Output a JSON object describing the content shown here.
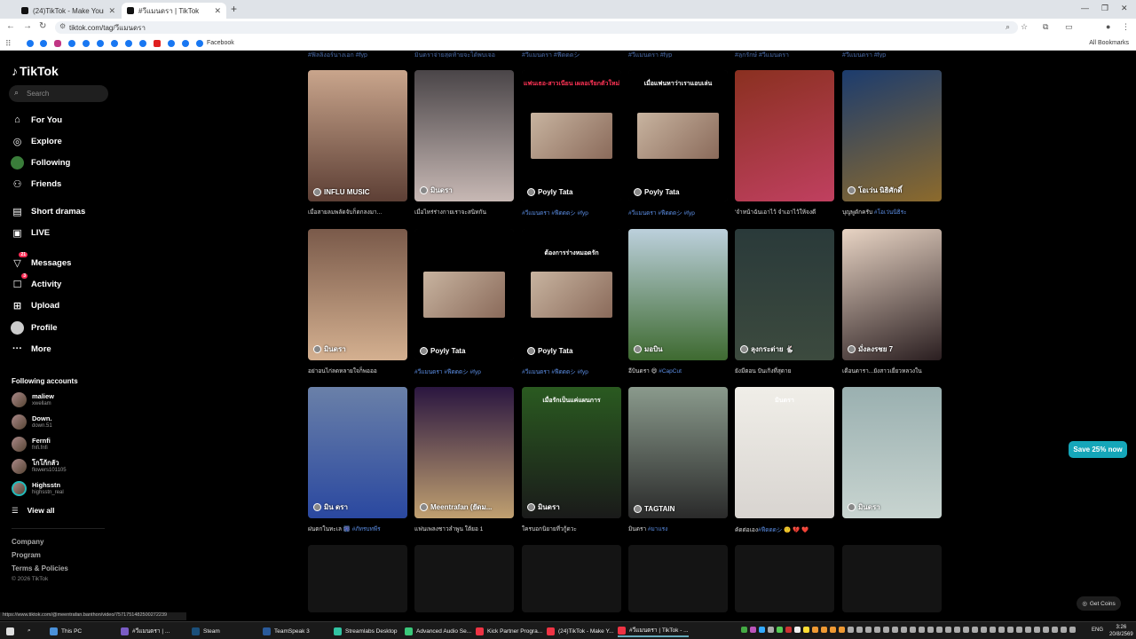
{
  "browser": {
    "tabs": [
      {
        "title": "(24)TikTok - Make Your Day",
        "active": false
      },
      {
        "title": "#วีแมนดรา | TikTok",
        "active": true
      }
    ],
    "url": "tiktok.com/tag/วีแมนดรา",
    "bookmarks_label": "Facebook",
    "all_bookmarks": "All Bookmarks"
  },
  "sidebar": {
    "logo": "TikTok",
    "search_placeholder": "Search",
    "nav": [
      {
        "label": "For You",
        "icon": "home-icon"
      },
      {
        "label": "Explore",
        "icon": "compass-icon"
      },
      {
        "label": "Following",
        "icon": "following-avatar"
      },
      {
        "label": "Friends",
        "icon": "friends-icon"
      },
      {
        "label": "Short dramas",
        "icon": "film-icon"
      },
      {
        "label": "LIVE",
        "icon": "live-icon"
      },
      {
        "label": "Messages",
        "icon": "message-icon",
        "badge": "21"
      },
      {
        "label": "Activity",
        "icon": "activity-icon",
        "badge": "3"
      },
      {
        "label": "Upload",
        "icon": "upload-icon"
      },
      {
        "label": "Profile",
        "icon": "profile-avatar"
      },
      {
        "label": "More",
        "icon": "more-icon"
      }
    ],
    "following_title": "Following accounts",
    "accounts": [
      {
        "name": "maliew",
        "handle": "xwellam"
      },
      {
        "name": "Down.",
        "handle": "down.51"
      },
      {
        "name": "Fernfi",
        "handle": "fnfi.fnfi"
      },
      {
        "name": "โกโก้กลัว",
        "handle": "flowers101105"
      },
      {
        "name": "Highsstn",
        "handle": "highsstn_real"
      }
    ],
    "view_all": "View all",
    "footer": [
      "Company",
      "Program",
      "Terms & Policies"
    ],
    "copyright": "© 2026 TikTok"
  },
  "grid": {
    "top_row_partial": [
      "#ฟิลลิงอร์นางเอก #fyp",
      "มินดราจ่ายสุดท้ายจะได้พบเจอ",
      "#วีแมนดรา #ฟีดดดシ",
      "#วีแมนดรา #fyp",
      "#ลูกรักษ์ #วีแมนดรา",
      "#วีแมนดรา #fyp"
    ],
    "rows": [
      [
        {
          "owner": "INFLU MUSIC",
          "caption": "เมื่อสายลมพลัดจับก็ตกลงมา...",
          "tag": "",
          "overlay": ""
        },
        {
          "owner": "มินดรา",
          "caption": "เมื่อไหร่ร่างกายเราจะสนิทกัน",
          "tag": "",
          "overlay": ""
        },
        {
          "owner": "Poyly Tata",
          "caption": "",
          "tag": "#วีแมนดรา #ฟีดดดシ #fyp",
          "overlay": "แฟนเธอ-สาวเนียน เผลอเรียกตัวใหม่"
        },
        {
          "owner": "Poyly Tata",
          "caption": "",
          "tag": "#วีแมนดรา #ฟีดดดシ #fyp",
          "overlay": "เมื่อแฟนหาว่าเราแอบเล่น"
        },
        {
          "owner": "",
          "caption": "'จำหน้าฉันเอาไว้ จำเอาไว้ให้จงดี",
          "tag": "",
          "overlay": ""
        },
        {
          "owner": "โอเว่น นิธิศักดิ์",
          "caption": "บุญพูดักครับ ",
          "tag": "#โอเว่นนิธิระ",
          "overlay": ""
        }
      ],
      [
        {
          "owner": "มินดรา",
          "caption": "อย่าอนไก่ลดหลายใจก็พอออ",
          "tag": "",
          "overlay": ""
        },
        {
          "owner": "Poyly Tata",
          "caption": "",
          "tag": "#วีแมนดรา #ฟีดดดシ #fyp",
          "overlay": ""
        },
        {
          "owner": "Poyly Tata",
          "caption": "",
          "tag": "#วีแมนดรา #ฟีดดดシ #fyp",
          "overlay": "ต้องการร่างหมอดรัก"
        },
        {
          "owner": "มอบิน",
          "caption": "อีบินดรา 😄 ",
          "tag": "#CapCut",
          "overlay": ""
        },
        {
          "owner": "ลุงกระต่าย 🐇",
          "caption": "ยังมีตอน ปันเกิงที่สุดาย",
          "tag": "",
          "overlay": ""
        },
        {
          "owner": "มั่งลงรชย 7",
          "caption": "เดือนดารา...ยังสาวเยี่ยวหลวงใน",
          "tag": "",
          "overlay": ""
        }
      ],
      [
        {
          "owner": "มิน ดรา",
          "caption": "ฝนตกในทะเล 🎆 ",
          "tag": "#ภัทรบทพีร",
          "overlay": ""
        },
        {
          "owner": "Meentrafan (ยัดม...",
          "caption": "แฟนเพลงชาวลำพูน ใต้ยอ 1",
          "tag": "",
          "overlay": ""
        },
        {
          "owner": "มินดรา",
          "caption": "ใครบอกนิยายที่วกู้ดวะ",
          "tag": "",
          "overlay": "เมื่อรักเป็นแค่แผนการ"
        },
        {
          "owner": "TAGTAIN",
          "caption": "มินดรา ",
          "tag": "#มาแรง",
          "overlay": ""
        },
        {
          "owner": "",
          "caption": "คัดต่อเอง",
          "tag": "#ฟีดดดシ 🙂 💔 ❤️",
          "overlay": "มินดรา"
        },
        {
          "owner": "มินดรา",
          "caption": "",
          "tag": "",
          "overlay": ""
        }
      ]
    ]
  },
  "promo": {
    "save": "Save 25% now",
    "coins": "Get Coins"
  },
  "status_url": "https://www.tiktok.com/@meentrafan.banthon/video/7571751482500272239",
  "taskbar": {
    "items": [
      "This PC",
      "#วีแมนดรา | ...",
      "Steam",
      "TeamSpeak 3",
      "Streamlabs Desktop",
      "Advanced Audio Se...",
      "Kick Partner Progra...",
      "(24)TikTok - Make Y...",
      "#วีแมนดรา | TikTok - ..."
    ],
    "lang": "ENG",
    "time": "3:26",
    "date": "20/8/2569"
  }
}
